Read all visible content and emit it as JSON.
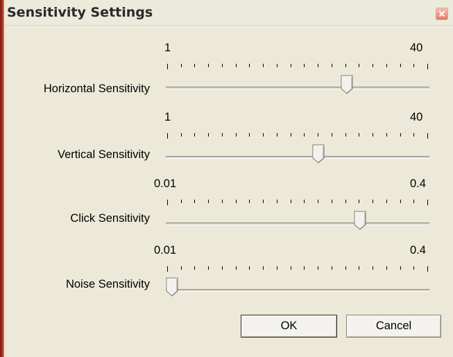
{
  "window": {
    "title": "Sensitivity Settings"
  },
  "sliders": [
    {
      "label": "Horizontal Sensitivity",
      "min": "1",
      "max": "40",
      "value_fraction": 0.69
    },
    {
      "label": "Vertical Sensitivity",
      "min": "1",
      "max": "40",
      "value_fraction": 0.58
    },
    {
      "label": "Click Sensitivity",
      "min": "0.01",
      "max": "0.4",
      "value_fraction": 0.74
    },
    {
      "label": "Noise Sensitivity",
      "min": "0.01",
      "max": "0.4",
      "value_fraction": 0.0
    }
  ],
  "buttons": {
    "ok": "OK",
    "cancel": "Cancel"
  },
  "icons": {
    "close": "close-icon"
  }
}
